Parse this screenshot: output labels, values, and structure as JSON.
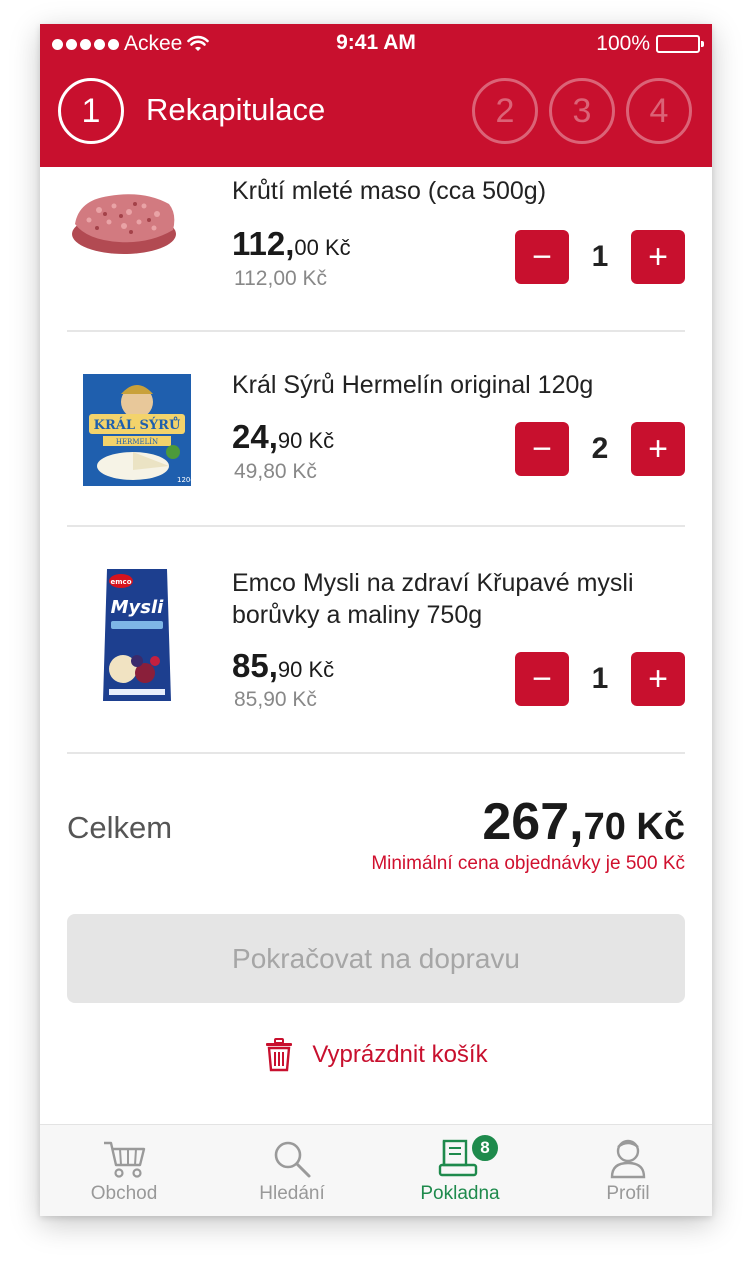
{
  "status_bar": {
    "carrier": "Ackee",
    "time": "9:41 AM",
    "battery": "100%"
  },
  "header": {
    "current_step": "1",
    "title": "Rekapitulace",
    "steps": [
      "2",
      "3",
      "4"
    ]
  },
  "cart": {
    "items": [
      {
        "name": "Krůtí mleté maso (cca 500g)",
        "price_main": "112,",
        "price_cents": "00 Kč",
        "old_price": "112,00 Kč",
        "quantity": "1",
        "image": "minced-meat-image"
      },
      {
        "name": "Král Sýrů Hermelín original 120g",
        "price_main": "24,",
        "price_cents": "90 Kč",
        "old_price": "49,80 Kč",
        "quantity": "2",
        "image": "cheese-box-image",
        "image_text": {
          "brand": "KRÁL SÝRŮ",
          "variety": "HERMELÍN",
          "weight": "120g"
        }
      },
      {
        "name": "Emco Mysli na zdraví Křupavé mysli borůvky a maliny 750g",
        "price_main": "85,",
        "price_cents": "90 Kč",
        "old_price": "85,90 Kč",
        "quantity": "1",
        "image": "muesli-bag-image",
        "image_text": {
          "brand": "emco",
          "product": "Mysli"
        }
      }
    ],
    "minus_icon": "minus-icon",
    "plus_icon": "plus-icon"
  },
  "summary": {
    "total_label": "Celkem",
    "total_main": "267,",
    "total_cents": "70 Kč",
    "min_order_note": "Minimální cena objednávky je 500 Kč"
  },
  "actions": {
    "continue_label": "Pokračovat na dopravu",
    "empty_cart_label": "Vyprázdnit košík"
  },
  "tabbar": {
    "tabs": [
      {
        "label": "Obchod",
        "icon": "cart-icon"
      },
      {
        "label": "Hledání",
        "icon": "search-icon"
      },
      {
        "label": "Pokladna",
        "icon": "checkout-icon",
        "badge": "8"
      },
      {
        "label": "Profil",
        "icon": "profile-icon"
      }
    ],
    "active_tab": "Pokladna"
  },
  "colors": {
    "brand_red": "#c8102e",
    "active_green": "#1e8a4c",
    "disabled_gray": "#e5e5e5"
  }
}
